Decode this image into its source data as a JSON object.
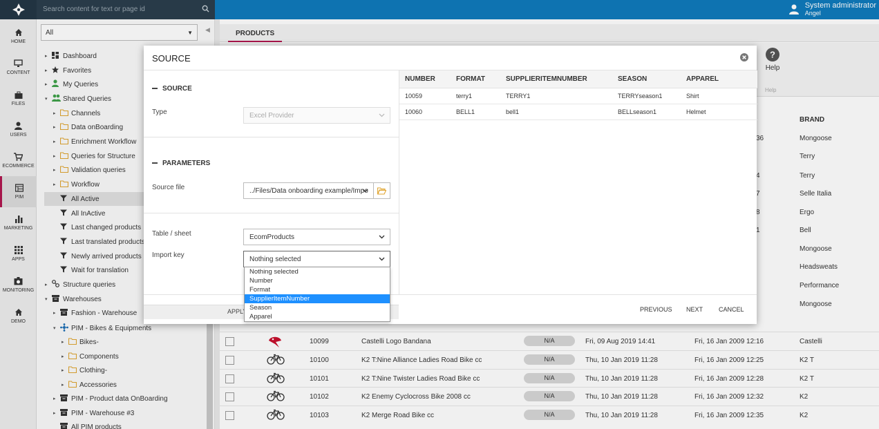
{
  "header": {
    "search_placeholder": "Search content for text or page id",
    "user_name": "System administrator",
    "user_sub": "Angel"
  },
  "rail": [
    {
      "label": "HOME",
      "icon": "home-icon"
    },
    {
      "label": "CONTENT",
      "icon": "monitor-icon"
    },
    {
      "label": "FILES",
      "icon": "briefcase-icon"
    },
    {
      "label": "USERS",
      "icon": "user-icon"
    },
    {
      "label": "ECOMMERCE",
      "icon": "cart-icon"
    },
    {
      "label": "PIM",
      "icon": "pim-icon"
    },
    {
      "label": "MARKETING",
      "icon": "bar-chart-icon"
    },
    {
      "label": "APPS",
      "icon": "apps-grid-icon"
    },
    {
      "label": "MONITORING",
      "icon": "monitoring-icon"
    },
    {
      "label": "DEMO",
      "icon": "home-icon"
    }
  ],
  "tree": {
    "filter_value": "All",
    "items": [
      {
        "label": "Dashboard",
        "icon": "dashboard-icon"
      },
      {
        "label": "Favorites",
        "icon": "star-icon"
      },
      {
        "label": "My Queries",
        "icon": "person-icon"
      },
      {
        "label": "Shared Queries",
        "icon": "group-icon"
      },
      {
        "label": "Channels",
        "icon": "folder-icon"
      },
      {
        "label": "Data onBoarding",
        "icon": "folder-icon"
      },
      {
        "label": "Enrichment Workflow",
        "icon": "folder-icon"
      },
      {
        "label": "Queries for Structure",
        "icon": "folder-icon"
      },
      {
        "label": "Validation queries",
        "icon": "folder-icon"
      },
      {
        "label": "Workflow",
        "icon": "folder-icon"
      },
      {
        "label": "All Active",
        "icon": "filter-icon"
      },
      {
        "label": "All InActive",
        "icon": "filter-icon"
      },
      {
        "label": "Last changed products",
        "icon": "filter-icon"
      },
      {
        "label": "Last translated products",
        "icon": "filter-icon"
      },
      {
        "label": "Newly arrived products",
        "icon": "filter-icon"
      },
      {
        "label": "Wait for translation",
        "icon": "filter-icon"
      },
      {
        "label": "Structure queries",
        "icon": "structure-icon"
      },
      {
        "label": "Warehouses",
        "icon": "warehouse-icon"
      },
      {
        "label": "Fashion - Warehouse",
        "icon": "warehouse-icon"
      },
      {
        "label": "PIM - Bikes & Equipments",
        "icon": "network-icon"
      },
      {
        "label": "Bikes-",
        "icon": "folder-icon"
      },
      {
        "label": "Components",
        "icon": "folder-icon"
      },
      {
        "label": "Clothing-",
        "icon": "folder-icon"
      },
      {
        "label": "Accessories",
        "icon": "folder-icon"
      },
      {
        "label": "PIM - Product data OnBoarding",
        "icon": "warehouse-icon"
      },
      {
        "label": "PIM - Warehouse #3",
        "icon": "warehouse-icon"
      },
      {
        "label": "All PIM products",
        "icon": "warehouse-icon"
      }
    ]
  },
  "main": {
    "tab": "PRODUCTS",
    "help_label": "Help",
    "help_group": "Help",
    "brand_header": "BRAND",
    "partial_cells": [
      "36",
      "4",
      "7",
      "8",
      "1"
    ],
    "brands_top": [
      "Mongoose",
      "Terry",
      "Terry",
      "Selle Italia",
      "Ergo",
      "Bell",
      "Mongoose",
      "Headsweats",
      "Performance",
      "Mongoose"
    ],
    "rows": [
      {
        "number": "10099",
        "name": "Castelli Logo Bandana",
        "status": "N/A",
        "date1": "Fri, 09 Aug 2019 14:41",
        "date2": "Fri, 16 Jan 2009 12:16",
        "brand": "Castelli",
        "img": "bandana"
      },
      {
        "number": "10100",
        "name": "K2 T:Nine Alliance Ladies Road Bike cc",
        "status": "N/A",
        "date1": "Thu, 10 Jan 2019 11:28",
        "date2": "Fri, 16 Jan 2009 12:25",
        "brand": "K2 T",
        "img": "bike"
      },
      {
        "number": "10101",
        "name": "K2 T:Nine Twister Ladies Road Bike cc",
        "status": "N/A",
        "date1": "Thu, 10 Jan 2019 11:28",
        "date2": "Fri, 16 Jan 2009 12:28",
        "brand": "K2 T",
        "img": "bike"
      },
      {
        "number": "10102",
        "name": "K2 Enemy Cyclocross Bike 2008 cc",
        "status": "N/A",
        "date1": "Thu, 10 Jan 2019 11:28",
        "date2": "Fri, 16 Jan 2009 12:32",
        "brand": "K2",
        "img": "bike"
      },
      {
        "number": "10103",
        "name": "K2 Merge Road Bike cc",
        "status": "N/A",
        "date1": "Thu, 10 Jan 2019 11:28",
        "date2": "Fri, 16 Jan 2009 12:35",
        "brand": "K2",
        "img": "bike"
      }
    ]
  },
  "dialog": {
    "title": "SOURCE",
    "source_section": "SOURCE",
    "type_label": "Type",
    "type_value": "Excel Provider",
    "parameters_section": "PARAMETERS",
    "source_file_label": "Source file",
    "source_file_value": "../Files/Data onboarding example/Impo",
    "table_label": "Table / sheet",
    "table_value": "EcomProducts",
    "import_key_label": "Import key",
    "import_key_value": "Nothing selected",
    "apply_label": "APPLY",
    "preview_headers": [
      "NUMBER",
      "FORMAT",
      "SUPPLIERITEMNUMBER",
      "SEASON",
      "APPAREL"
    ],
    "preview_rows": [
      [
        "10059",
        "terry1",
        "TERRY1",
        "TERRYseason1",
        "Shirt"
      ],
      [
        "10060",
        "BELL1",
        "bell1",
        "BELLseason1",
        "Helmet"
      ]
    ],
    "buttons": {
      "previous": "PREVIOUS",
      "next": "NEXT",
      "cancel": "CANCEL"
    },
    "dropdown_options": [
      "Nothing selected",
      "Number",
      "Format",
      "SupplierItemNumber",
      "Season",
      "Apparel"
    ],
    "dropdown_highlighted": "SupplierItemNumber"
  }
}
